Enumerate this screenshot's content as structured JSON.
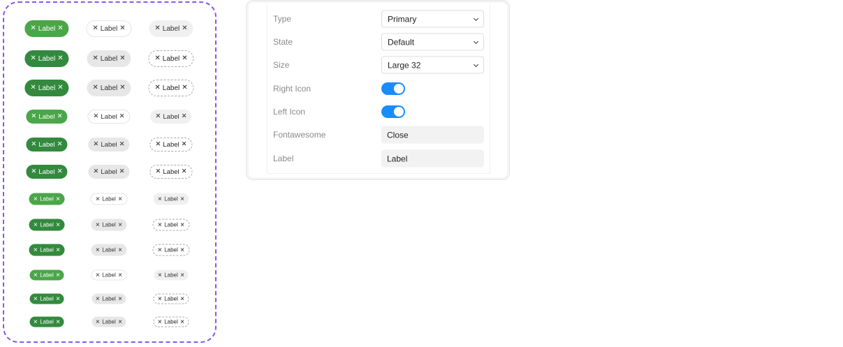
{
  "preview": {
    "chip_label": "Label",
    "close_glyph": "✕"
  },
  "properties": {
    "type": {
      "label": "Type",
      "value": "Primary"
    },
    "state": {
      "label": "State",
      "value": "Default"
    },
    "size": {
      "label": "Size",
      "value": "Large 32"
    },
    "right_icon": {
      "label": "Right Icon",
      "on": true
    },
    "left_icon": {
      "label": "Left Icon",
      "on": true
    },
    "fontawesome": {
      "label": "Fontawesome",
      "value": "Close"
    },
    "label": {
      "label": "Label",
      "value": "Label"
    }
  },
  "colors": {
    "accent_purple": "#8b55e6",
    "green_light": "#4aa648",
    "green_dark": "#338a3e",
    "toggle_blue": "#1a8cff"
  }
}
